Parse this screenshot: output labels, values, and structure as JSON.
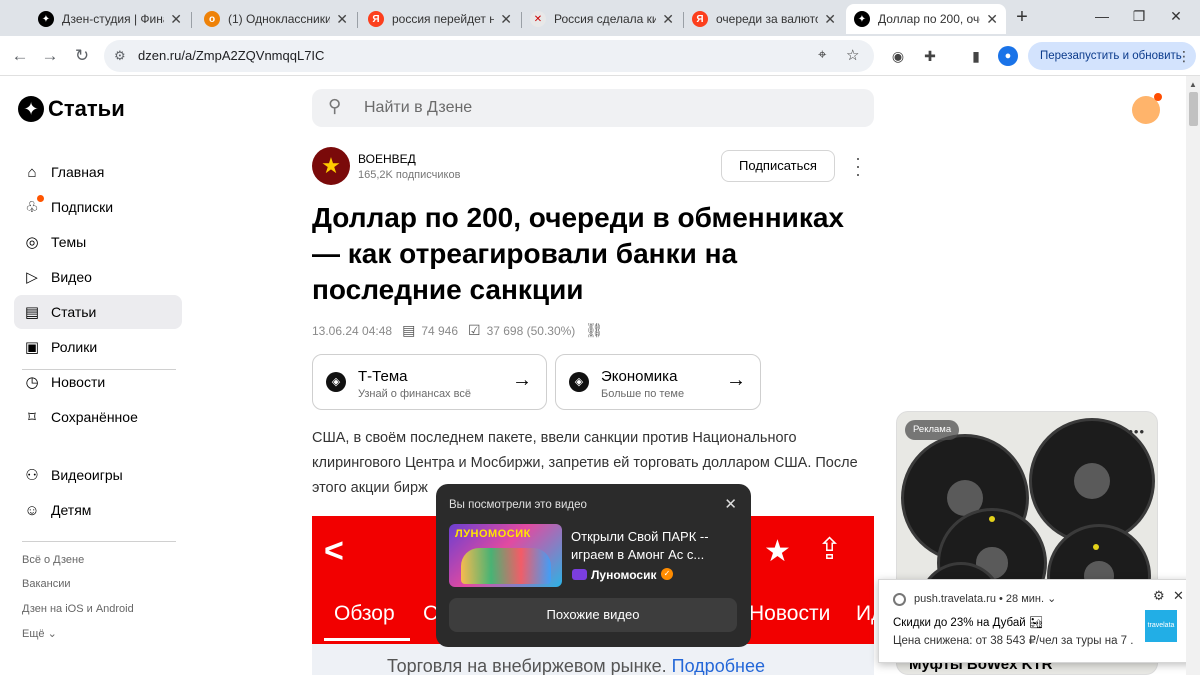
{
  "browser": {
    "tabs": [
      {
        "label": "Дзен-студия | Финан",
        "favicon": "dzen-icon",
        "color": "#000000",
        "glyph": "✦",
        "active": false
      },
      {
        "label": "(1) Одноклассники",
        "favicon": "ok-icon",
        "color": "#ee8208",
        "glyph": "о",
        "active": false
      },
      {
        "label": "россия перейдет на",
        "favicon": "yandex-icon",
        "color": "#fc3f1d",
        "glyph": "Я",
        "active": false
      },
      {
        "label": "Россия сделала кита",
        "favicon": "news-icon",
        "color": "#e8e8e8",
        "glyph": "✕",
        "active": false
      },
      {
        "label": "очереди за валютой",
        "favicon": "yandex-icon",
        "color": "#fc3f1d",
        "glyph": "Я",
        "active": false
      },
      {
        "label": "Доллар по 200, очере",
        "favicon": "dzen-icon",
        "color": "#000000",
        "glyph": "✦",
        "active": true
      }
    ],
    "url": "dzen.ru/a/ZmpA2ZQVnmqqL7IC",
    "relaunch_label": "Перезапустить и обновить"
  },
  "sidebar": {
    "logo": "Статьи",
    "items": [
      {
        "label": "Главная",
        "icon": "home-icon",
        "glyph": "⌂"
      },
      {
        "label": "Подписки",
        "icon": "subscriptions-icon",
        "glyph": "♧"
      },
      {
        "label": "Темы",
        "icon": "compass-icon",
        "glyph": "◎"
      },
      {
        "label": "Видео",
        "icon": "play-icon",
        "glyph": "▷"
      },
      {
        "label": "Статьи",
        "icon": "articles-icon",
        "glyph": "▤"
      },
      {
        "label": "Ролики",
        "icon": "clips-icon",
        "glyph": "▣"
      },
      {
        "label": "Новости",
        "icon": "news-icon",
        "glyph": "◷"
      },
      {
        "label": "Сохранённое",
        "icon": "bookmark-icon",
        "glyph": "⌑"
      },
      {
        "label": "Видеоигры",
        "icon": "gamepad-icon",
        "glyph": "⚇"
      },
      {
        "label": "Детям",
        "icon": "kids-icon",
        "glyph": "☺"
      }
    ],
    "footer_links": [
      "Всё о Дзене",
      "Вакансии",
      "Дзен на iOS и Android",
      "Ещё"
    ]
  },
  "search": {
    "placeholder": "Найти в Дзене"
  },
  "channel": {
    "name": "ВОЕНВЕД",
    "subscribers": "165,2K подписчиков",
    "subscribe_label": "Подписаться"
  },
  "article": {
    "title": "Доллар по 200, очереди в обменниках — как отреагировали банки на последние санкции",
    "date": "13.06.24 04:48",
    "views": "74 946",
    "reads": "37 698 (50.30%)",
    "body": "США, в своём последнем пакете, ввели санкции против Национального клирингового Центра и Мосбиржи, запретив ей торговать долларом США. После этого акции бирж"
  },
  "topics": [
    {
      "name": "Т-Тема",
      "sub": "Узнай о финансах всё"
    },
    {
      "name": "Экономика",
      "sub": "Больше по теме"
    }
  ],
  "video": {
    "tabs": [
      "Обзор",
      "С",
      "Новости",
      "Ид"
    ],
    "bottom_text": "Торговля на внебиржевом рынке.",
    "bottom_link": "Подробнее"
  },
  "popup": {
    "header": "Вы посмотрели это видео",
    "thumb_title": "ЛУНОМОСИК",
    "title": "Открыли Свой ПАРК -- играем в Амонг Ас с...",
    "channel": "Луномосик",
    "button": "Похожие видео"
  },
  "ad": {
    "label": "Реклама",
    "name": "Муфты BoWex KTR"
  },
  "notification": {
    "source": "push.travelata.ru",
    "time": "28 мин.",
    "title": "Скидки до 23% на Дубай 🏜",
    "body": "Цена снижена: от 38 543 ₽/чел за туры на 7 ...",
    "image_text": "travelata"
  }
}
